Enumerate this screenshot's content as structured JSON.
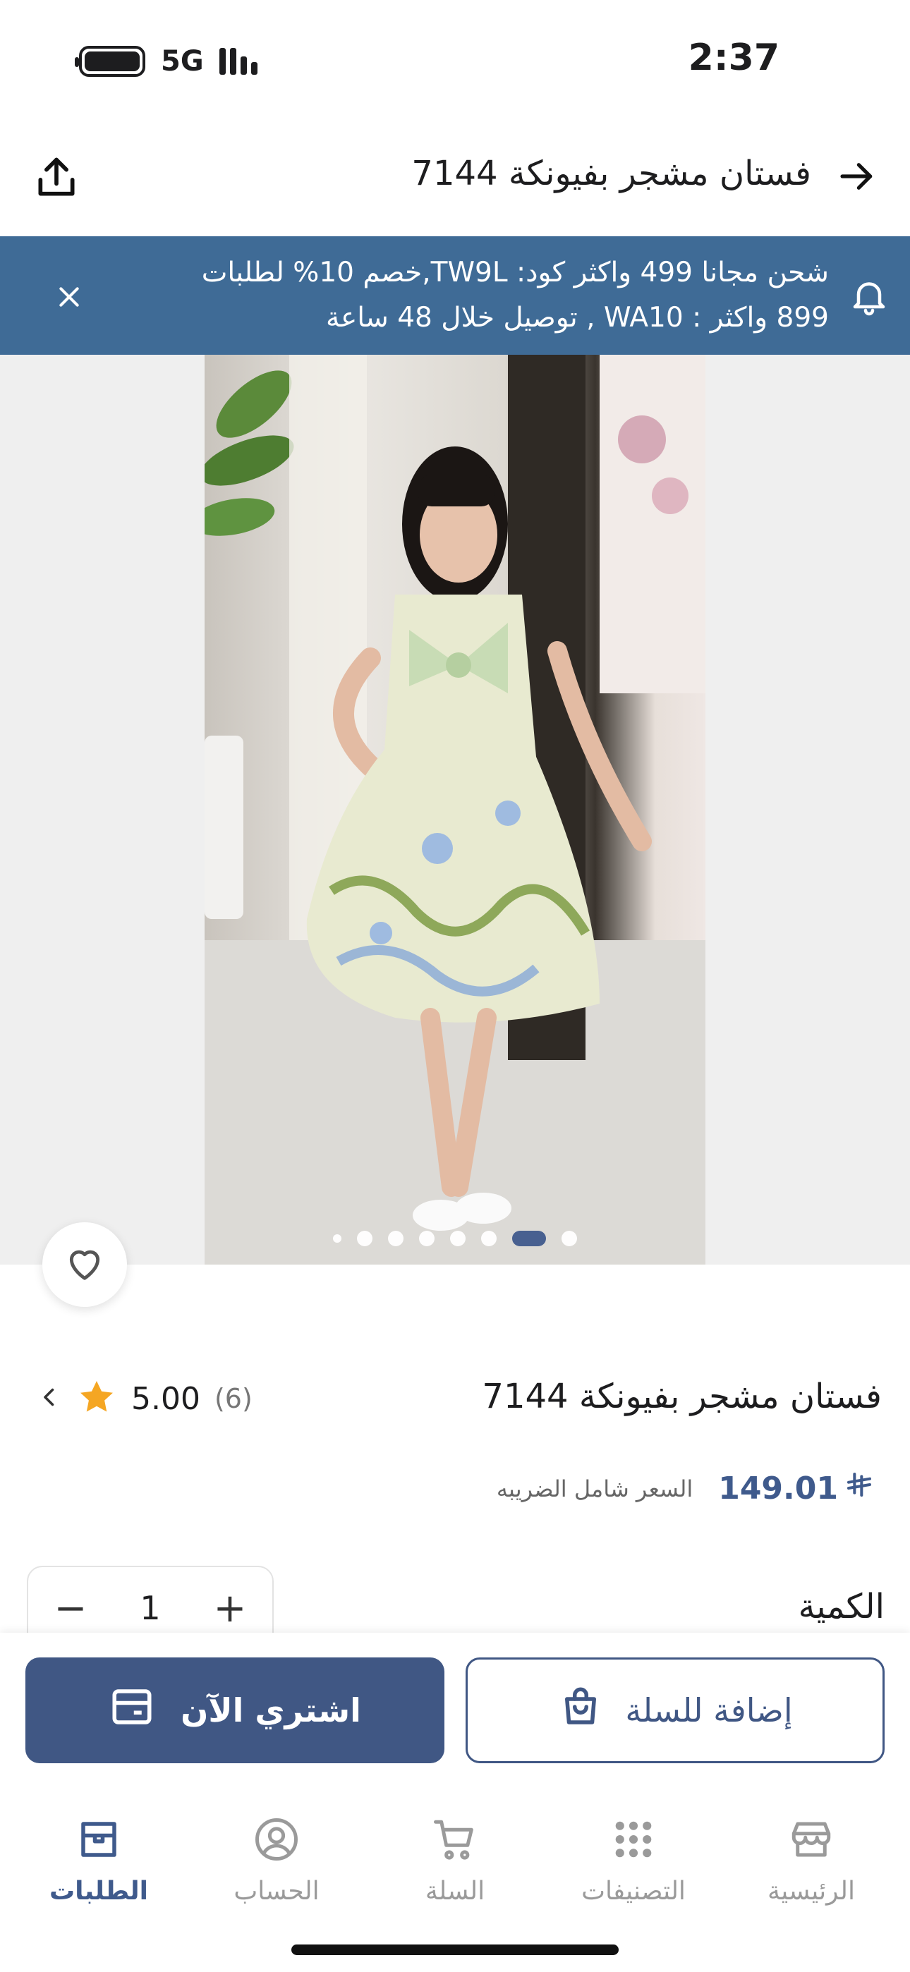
{
  "status_bar": {
    "time": "2:37",
    "network": "5G"
  },
  "header": {
    "title": "فستان مشجر بفيونكة 7144",
    "back_icon": "arrow-right-icon",
    "share_icon": "share-icon"
  },
  "banner": {
    "line1": "شحن مجانا 499 واكثر كود: TW9L,خصم 10% لطلبات",
    "line2": "899 واكثر : WA10 , توصيل خلال 48 ساعة",
    "background": "#3f6b96"
  },
  "gallery": {
    "image_count": 8,
    "active_index": 6
  },
  "product": {
    "name": "فستان مشجر بفيونكة 7144",
    "rating": "5.00",
    "reviews_count": "(6)",
    "price": "149.01",
    "currency_symbol": "⃁",
    "tax_note": "السعر شامل الضريبه"
  },
  "quantity": {
    "label": "الكمية",
    "value": "1",
    "minus": "−",
    "plus": "+"
  },
  "actions": {
    "buy_now": "اشتري الآن",
    "add_to_cart": "إضافة للسلة",
    "accent": "#405784"
  },
  "tabs": [
    {
      "label": "الرئيسية",
      "icon": "store-icon"
    },
    {
      "label": "التصنيفات",
      "icon": "grid-icon"
    },
    {
      "label": "السلة",
      "icon": "cart-icon"
    },
    {
      "label": "الحساب",
      "icon": "user-icon"
    },
    {
      "label": "الطلبات",
      "icon": "orders-box-icon",
      "active": true
    }
  ]
}
